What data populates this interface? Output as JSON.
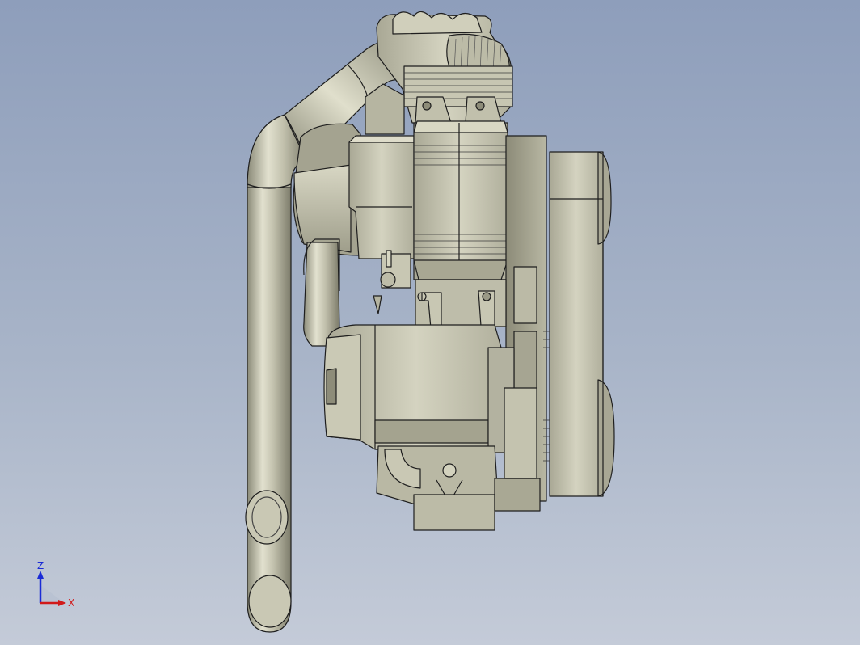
{
  "viewport": {
    "background_top": "#8e9ebb",
    "background_bottom": "#c4cbd8"
  },
  "model": {
    "shading_color": "#c9c8b4",
    "shadow_color": "#8f8e7c",
    "edge_color": "#1e1e1e"
  },
  "triad": {
    "z_label": "Z",
    "x_label": "X",
    "z_color": "#1a2bd6",
    "x_color": "#d11a1a"
  }
}
